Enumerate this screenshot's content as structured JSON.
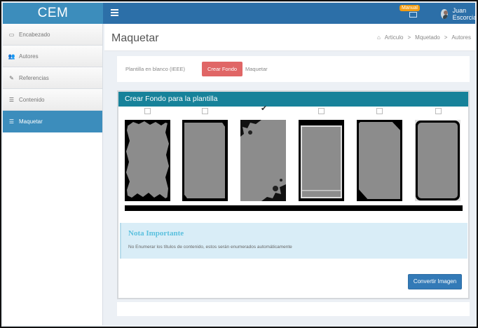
{
  "app": {
    "brand": "CEM"
  },
  "navbar": {
    "menu_badge": "Manual",
    "user_name": "Juan Escorcia",
    "user_caret": "▾"
  },
  "sidebar": {
    "items": [
      {
        "label": "Encabezado",
        "icon": "header-icon",
        "glyph": "▭"
      },
      {
        "label": "Autores",
        "icon": "users-icon",
        "glyph": "👥"
      },
      {
        "label": "Referencias",
        "icon": "edit-icon",
        "glyph": "✎"
      },
      {
        "label": "Contenido",
        "icon": "list-icon",
        "glyph": "☰"
      },
      {
        "label": "Maquetar",
        "icon": "list-icon",
        "glyph": "☰",
        "active": true
      }
    ]
  },
  "header": {
    "title": "Maquetar",
    "breadcrumb": [
      "Articulo",
      "Mquetado",
      "Autores"
    ],
    "breadcrumb_sep": ">"
  },
  "tabs": [
    {
      "label": "Plantilla en blanco (IEEE)"
    },
    {
      "label": "Crear Fondo",
      "active": true
    },
    {
      "label": "Maquetar"
    }
  ],
  "card": {
    "title": "Crear Fondo para la plantilla",
    "templates": [
      {
        "name": "template-grunge",
        "selected": false
      },
      {
        "name": "template-corner-curl",
        "selected": false
      },
      {
        "name": "template-splatter",
        "selected": true
      },
      {
        "name": "template-double-frame",
        "selected": false
      },
      {
        "name": "template-folded-corners",
        "selected": false
      },
      {
        "name": "template-rounded",
        "selected": false
      }
    ],
    "note_title": "Nota Importante",
    "note_text": "No Enumerar los títulos de contenido, estos serán enumerados automáticamente",
    "convert_label": "Convertir Imagen"
  },
  "colors": {
    "brand": "#3c8dbc",
    "navbar": "#2c6fa8",
    "active_tab": "#e06666",
    "card_header": "#17829a",
    "note_bg": "#d9edf7",
    "button": "#337ab7"
  }
}
